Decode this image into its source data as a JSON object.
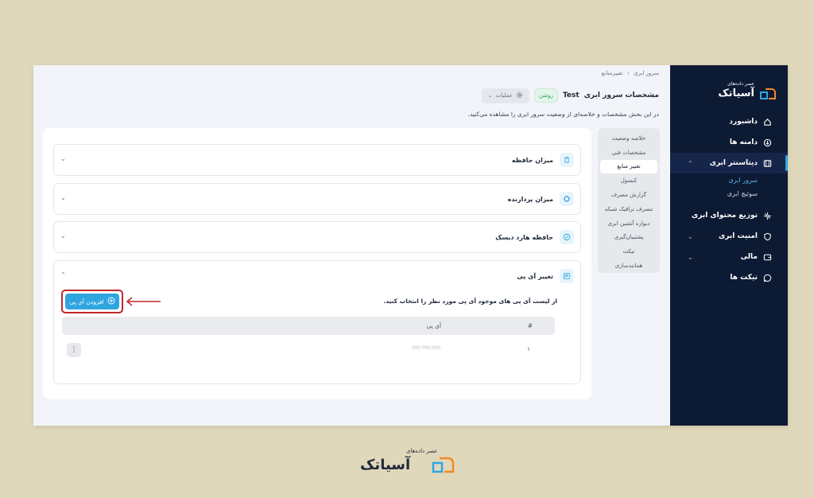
{
  "breadcrumb": {
    "root": "سرور ابری",
    "separator": "‹",
    "current": "تغییرمنابع"
  },
  "header": {
    "title": "مشخصات سرور ابری",
    "server_name": "Test",
    "status": "روشن",
    "operations": "عملیات"
  },
  "description": "در این بخش مشخصات و خلاصه‌ای از وضعیت سرور ابری را مشاهده می‌کنید.",
  "logo": {
    "subtitle": "عصر داده‌های",
    "name": "آسیاتک"
  },
  "sidebar": {
    "items": [
      {
        "label": "داشبورد",
        "icon": "home-icon"
      },
      {
        "label": "دامنه ها",
        "icon": "globe-icon"
      },
      {
        "label": "دیتاسنتر ابری",
        "icon": "server-icon"
      },
      {
        "label": "توزیع محتوای ابری",
        "icon": "network-icon"
      },
      {
        "label": "امنیت ابری",
        "icon": "shield-icon"
      },
      {
        "label": "مالی",
        "icon": "wallet-icon"
      },
      {
        "label": "تیکت ها",
        "icon": "chat-icon"
      }
    ],
    "subitems": [
      "سرور ابری",
      "سوئیچ ابری"
    ]
  },
  "tabs": [
    "خلاصه وضعیت",
    "مشخصات فنی",
    "تغییر منابع",
    "کنسول",
    "گزارش مصرف",
    "مصرف ترافیک شبکه",
    "دیواره آتشین ابری",
    "پشتیبان‌گیری",
    "تیکت",
    "همانندسازی"
  ],
  "accordions": [
    "میزان حافظه",
    "میزان پردازنده",
    "حافظه هارد دیسک",
    "تغییر آی پی"
  ],
  "ip_section": {
    "description": "از لیست آی پی های موجود آی پی مورد نظر را انتخاب کنید.",
    "add_button": "افزودن آی پی",
    "columns": [
      "#",
      "آی پی"
    ],
    "rows": [
      {
        "num": "۱",
        "ip": "***.***.***"
      }
    ]
  },
  "colors": {
    "sidebar_bg": "#0d1a33",
    "accent": "#2fa5e0",
    "highlight_border": "#c0262c",
    "status_green": "#22a35a"
  }
}
